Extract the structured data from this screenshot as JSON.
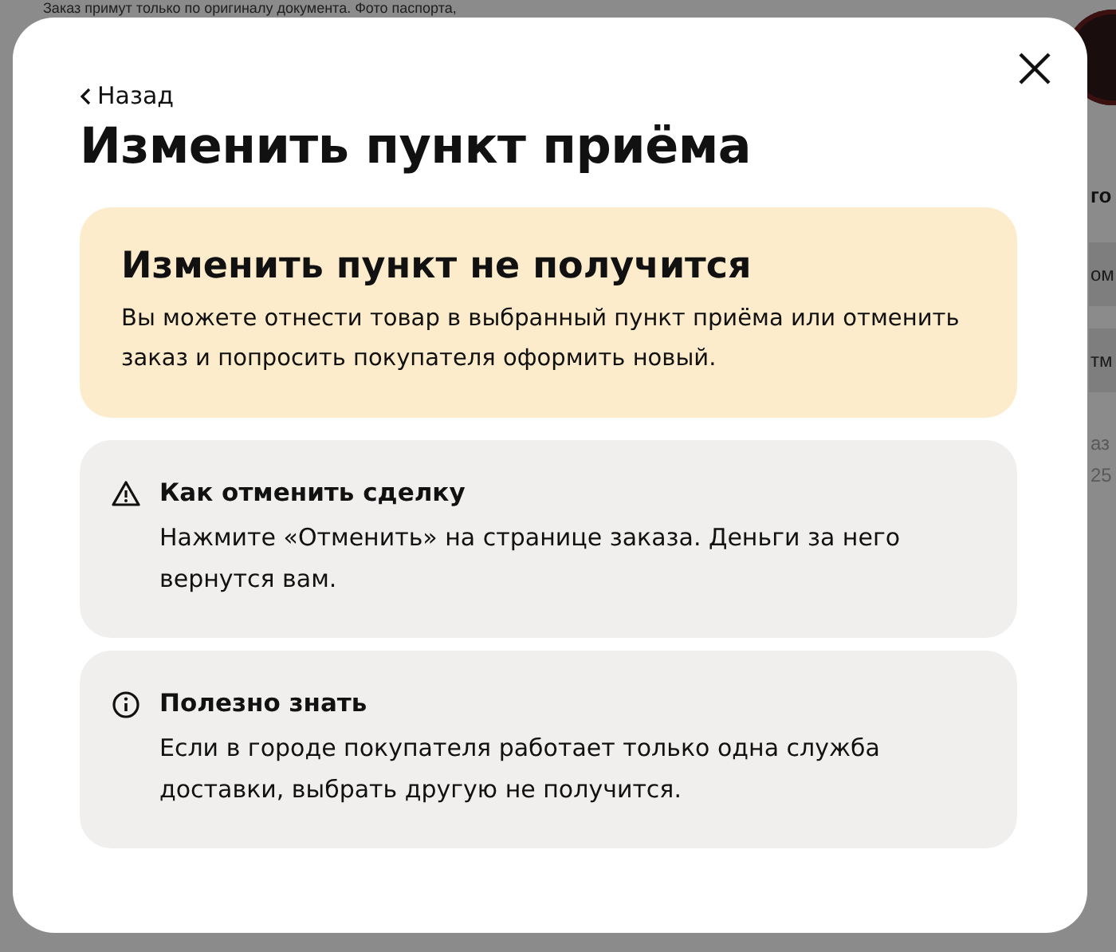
{
  "background": {
    "notice": "Заказ примут только по оригиналу документа. Фото паспорта,",
    "side_heading": "го",
    "side_buttons": [
      "ом",
      "тм"
    ],
    "side_text": [
      "аз",
      "25"
    ]
  },
  "modal": {
    "back_link": "Назад",
    "title": "Изменить пункт приёма",
    "cards": [
      {
        "kind": "warning",
        "title": "Изменить пункт не получится",
        "text": "Вы можете отнести товар в выбранный пункт приёма или отменить заказ и попросить покупателя оформить новый."
      },
      {
        "kind": "alert",
        "title": "Как отменить сделку",
        "text": "Нажмите «Отменить» на странице заказа. Деньги за него вернутся вам."
      },
      {
        "kind": "info",
        "title": "Полезно знать",
        "text": "Если в городе покупателя работает только одна служба доставки, выбрать другую не получится."
      }
    ]
  }
}
